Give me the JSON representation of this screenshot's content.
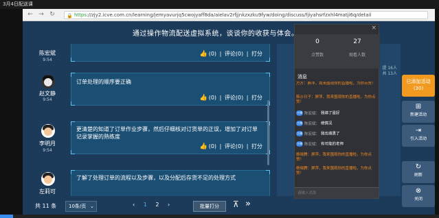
{
  "window_title": "3月4日配送课",
  "browser": {
    "back_icon": "arrow-left-icon",
    "forward_icon": "arrow-right-icon",
    "refresh_icon": "refresh-icon",
    "url_scheme": "https",
    "url_rest": "://zjy2.icve.com.cn/learning/jemyavurjq5cwojyaff8da/aielav2rfjjnkzxzku9fyw/doing/discuss/fjiyahsrfzxhl4matji6q/detail"
  },
  "page_title": "通过操作物流配送虚拟系统，谈谈你的收获与体会。",
  "posts": [
    {
      "author": "陈宏斌",
      "time": "9:54",
      "text": "",
      "likes": "(0)",
      "comment": "评论(0)",
      "score": "打分"
    },
    {
      "author": "赵文静",
      "time": "9:54",
      "text": "订单处理的顺序要正确",
      "likes": "(0)",
      "comment": "评论(0)",
      "score": "打分"
    },
    {
      "author": "李明月",
      "time": "9:54",
      "text": "更清楚的知道了订单作业步骤，然后仔细核对订货单的正误，增加了对订单记录掌握的熟练度",
      "likes": "(0)",
      "comment": "评论(0)",
      "score": "打分"
    },
    {
      "author": "左莉可",
      "time": "",
      "text": "了解了处理订单的流程以及步骤，以及分配后存货不足的处理方式",
      "likes": "",
      "comment": "",
      "score": ""
    }
  ],
  "footer": {
    "total": "共 11 条",
    "per_page": "10条/页",
    "prev": "‹",
    "pages": [
      "1",
      "2"
    ],
    "next": "›",
    "bulk_score": "批量打分",
    "to_top": "⊼",
    "skip": "»"
  },
  "right_pane": {
    "mini1": "提 16人",
    "mini2": "共 13人"
  },
  "chat": {
    "close": "×",
    "stats": [
      {
        "num": "0",
        "label": "点赞数"
      },
      {
        "num": "27",
        "label": "观看人数"
      }
    ],
    "messages_title": "消息",
    "messages": [
      {
        "kind": "orange",
        "text": "方方：屏萍，我来围观你的直播啦，为你点赞！"
      },
      {
        "kind": "orange",
        "text": "韩沙日子：屏萍，我来围观你的直播啦，为你点赞！"
      },
      {
        "kind": "blue",
        "badge": "主播",
        "who": "陈宏斌：",
        "text": "我填了是好"
      },
      {
        "kind": "blue",
        "badge": "主播",
        "who": "陈宏斌：",
        "text": "继情况"
      },
      {
        "kind": "blue",
        "badge": "主播",
        "who": "陈宏斌：",
        "text": "我也填黑了"
      },
      {
        "kind": "blue",
        "badge": "主播",
        "who": "陈宏斌：",
        "text": "有可能的老师"
      },
      {
        "kind": "orange",
        "text": "杨晓腾：屏萍，我来围观你的直播啦，为你点赞！"
      },
      {
        "kind": "orange",
        "text": "杨晓腾：屏萍，我来围观你的直播啦，为你点赞！"
      }
    ],
    "input_placeholder": "请输入消息"
  },
  "side_buttons": [
    {
      "label": "已添加活动",
      "sub": "(30)",
      "icon": ""
    },
    {
      "label": "新建活动",
      "sub": "",
      "icon": "plus-icon"
    },
    {
      "label": "引入活动",
      "sub": "",
      "icon": "import-icon"
    },
    {
      "label": "刷新",
      "sub": "",
      "icon": "refresh-icon"
    },
    {
      "label": "关闭",
      "sub": "",
      "icon": "close-icon"
    }
  ],
  "video_progress_fraction": 0.03
}
